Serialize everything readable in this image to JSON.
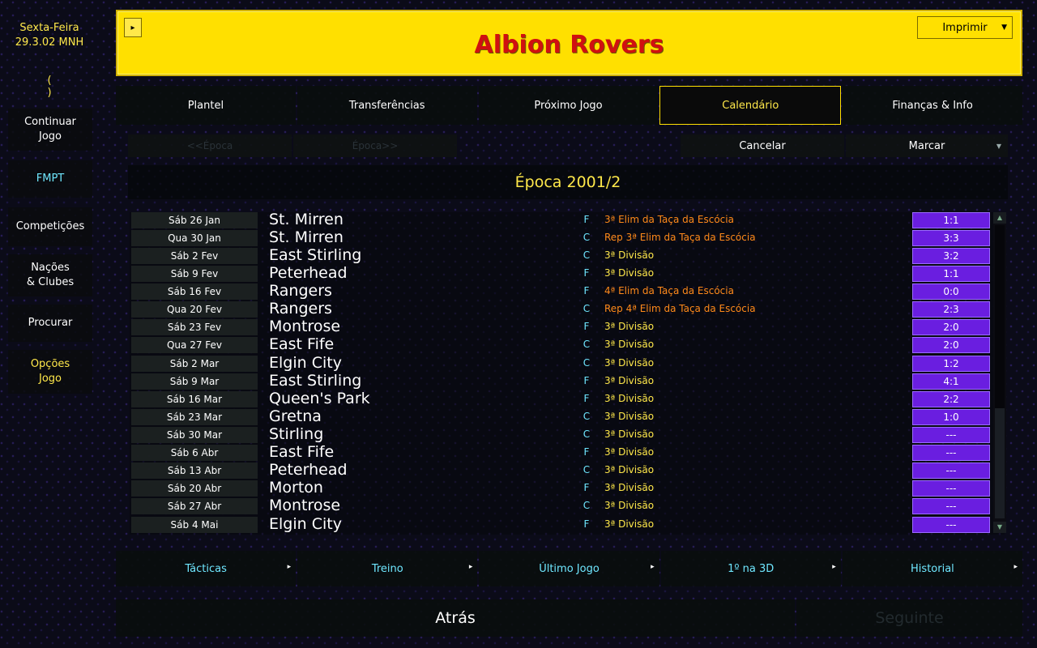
{
  "sidebar": {
    "weekday": "Sexta-Feira",
    "date": "29.3.02 MNH",
    "paren_open": "(",
    "paren_close": ")",
    "continue_line1": "Continuar",
    "continue_line2": "Jogo",
    "fmpt": "FMPT",
    "competitions": "Competições",
    "nations_line1": "Nações",
    "nations_line2": "& Clubes",
    "search": "Procurar",
    "options_line1": "Opções",
    "options_line2": "Jogo"
  },
  "header": {
    "title": "Albion Rovers",
    "print_label": "Imprimir",
    "menu_arrow": "▸",
    "print_caret": "▼"
  },
  "tabs": [
    "Plantel",
    "Transferências",
    "Próximo Jogo",
    "Calendário",
    "Finanças & Info"
  ],
  "toolbar": {
    "prev_season": "<<Época",
    "next_season": "Época>>",
    "cancel": "Cancelar",
    "mark": "Marcar",
    "mark_caret": "▼"
  },
  "season_title": "Época 2001/2",
  "fixtures": [
    {
      "date": "Sáb 26 Jan",
      "team": "St. Mirren",
      "venue": "F",
      "comp": "3ª Elim da Taça da Escócia",
      "type": "cup",
      "score": "1:1"
    },
    {
      "date": "Qua 30 Jan",
      "team": "St. Mirren",
      "venue": "C",
      "comp": "Rep 3ª Elim da Taça da Escócia",
      "type": "cup",
      "score": "3:3"
    },
    {
      "date": "Sáb 2 Fev",
      "team": "East Stirling",
      "venue": "C",
      "comp": "3ª Divisão",
      "type": "league",
      "score": "3:2"
    },
    {
      "date": "Sáb 9 Fev",
      "team": "Peterhead",
      "venue": "F",
      "comp": "3ª Divisão",
      "type": "league",
      "score": "1:1"
    },
    {
      "date": "Sáb 16 Fev",
      "team": "Rangers",
      "venue": "F",
      "comp": "4ª Elim da Taça da Escócia",
      "type": "cup",
      "score": "0:0"
    },
    {
      "date": "Qua 20 Fev",
      "team": "Rangers",
      "venue": "C",
      "comp": "Rep 4ª Elim da Taça da Escócia",
      "type": "cup",
      "score": "2:3"
    },
    {
      "date": "Sáb 23 Fev",
      "team": "Montrose",
      "venue": "F",
      "comp": "3ª Divisão",
      "type": "league",
      "score": "2:0"
    },
    {
      "date": "Qua 27 Fev",
      "team": "East Fife",
      "venue": "C",
      "comp": "3ª Divisão",
      "type": "league",
      "score": "2:0"
    },
    {
      "date": "Sáb 2 Mar",
      "team": "Elgin City",
      "venue": "C",
      "comp": "3ª Divisão",
      "type": "league",
      "score": "1:2"
    },
    {
      "date": "Sáb 9 Mar",
      "team": "East Stirling",
      "venue": "F",
      "comp": "3ª Divisão",
      "type": "league",
      "score": "4:1"
    },
    {
      "date": "Sáb 16 Mar",
      "team": "Queen's Park",
      "venue": "F",
      "comp": "3ª Divisão",
      "type": "league",
      "score": "2:2"
    },
    {
      "date": "Sáb 23 Mar",
      "team": "Gretna",
      "venue": "C",
      "comp": "3ª Divisão",
      "type": "league",
      "score": "1:0"
    },
    {
      "date": "Sáb 30 Mar",
      "team": "Stirling",
      "venue": "C",
      "comp": "3ª Divisão",
      "type": "league",
      "score": "---"
    },
    {
      "date": "Sáb 6 Abr",
      "team": "East Fife",
      "venue": "F",
      "comp": "3ª Divisão",
      "type": "league",
      "score": "---"
    },
    {
      "date": "Sáb 13 Abr",
      "team": "Peterhead",
      "venue": "C",
      "comp": "3ª Divisão",
      "type": "league",
      "score": "---"
    },
    {
      "date": "Sáb 20 Abr",
      "team": "Morton",
      "venue": "F",
      "comp": "3ª Divisão",
      "type": "league",
      "score": "---"
    },
    {
      "date": "Sáb 27 Abr",
      "team": "Montrose",
      "venue": "C",
      "comp": "3ª Divisão",
      "type": "league",
      "score": "---"
    },
    {
      "date": "Sáb 4 Mai",
      "team": "Elgin City",
      "venue": "F",
      "comp": "3ª Divisão",
      "type": "league",
      "score": "---"
    }
  ],
  "bottom_tabs": [
    "Tácticas",
    "Treino",
    "Último Jogo",
    "1º na 3D",
    "Historial"
  ],
  "bottom_tab_arrow": "▸",
  "scroll": {
    "up": "▲",
    "down": "▼"
  },
  "nav": {
    "back": "Atrás",
    "next": "Seguinte"
  },
  "colors": {
    "header_bg": "#ffe000",
    "title": "#d01010",
    "accent": "#ffe84a",
    "cyan": "#6fe7ff",
    "cup": "#ff8a1a",
    "score_bg": "#6a1ee0"
  }
}
